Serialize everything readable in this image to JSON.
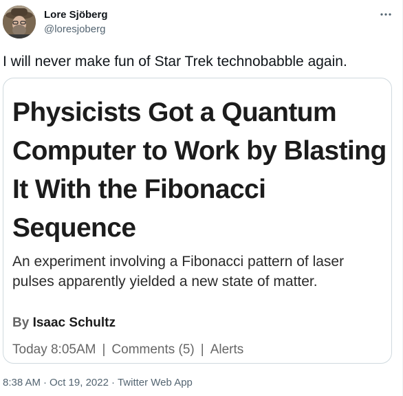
{
  "author": {
    "name": "Lore Sjöberg",
    "handle": "@loresjoberg",
    "avatar": "avatar-photo"
  },
  "more_icon": "more-horizontal-icon",
  "tweet": {
    "text": "I will never make fun of Star Trek technobabble again."
  },
  "card": {
    "headline": "Physicists Got a Quantum\nComputer to Work by Blasting\nIt With the Fibonacci\nSequence",
    "subhead": "An experiment involving a Fibonacci pattern of laser\npulses apparently yielded a new state of matter.",
    "by_prefix": "By",
    "author": "Isaac Schultz",
    "time": "Today 8:05AM",
    "separator": "|",
    "comments": "Comments (5)",
    "alerts": "Alerts"
  },
  "footer": {
    "time": "8:38 AM",
    "dot": "·",
    "date": "Oct 19, 2022",
    "source": "Twitter Web App"
  },
  "colors": {
    "text_primary": "#0f1419",
    "text_secondary": "#536471",
    "card_border": "#cfd9de",
    "headline": "#1c1c1c",
    "card_meta": "#666666"
  }
}
